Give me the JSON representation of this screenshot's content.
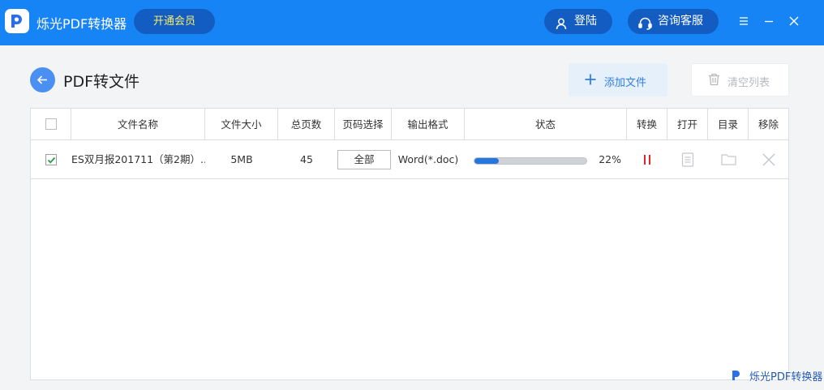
{
  "app": {
    "title": "烁光PDF转换器",
    "vip_label": "开通会员",
    "login_label": "登陆",
    "service_label": "咨询客服"
  },
  "toolbar": {
    "page_title": "PDF转文件",
    "add_label": "添加文件",
    "clear_label": "清空列表"
  },
  "table": {
    "headers": {
      "name": "文件名称",
      "size": "文件大小",
      "pages": "总页数",
      "page_select": "页码选择",
      "format": "输出格式",
      "status": "状态",
      "convert": "转换",
      "open": "打开",
      "folder": "目录",
      "remove": "移除"
    },
    "rows": [
      {
        "checked": true,
        "name": "ES双月报201711（第2期）....",
        "size": "5MB",
        "pages": "45",
        "page_select": "全部",
        "format": "Word(*.doc)",
        "progress": 0.22,
        "progress_label": "22%"
      }
    ]
  },
  "watermark": {
    "text": "烁光PDF转换器"
  },
  "colors": {
    "titlebar": "#1784f5",
    "accent": "#2577de",
    "vip_text": "#f7ef6a",
    "pause": "#e0262d"
  }
}
